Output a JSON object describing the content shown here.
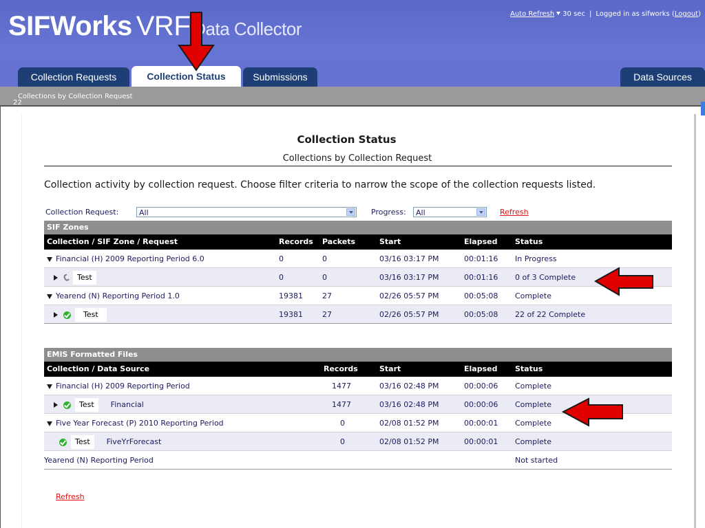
{
  "header": {
    "brand_bold": "SIFWorks",
    "brand_vrf": "VRF",
    "brand_dc": "Data Collector",
    "auto_refresh": "Auto Refresh",
    "refresh_interval": "30 sec",
    "logged_in_prefix": "Logged in as sifworks (",
    "logout": "Logout",
    "logged_in_suffix": ")"
  },
  "tabs": [
    {
      "label": "Collection Requests",
      "active": false
    },
    {
      "label": "Collection Status",
      "active": true
    },
    {
      "label": "Submissions",
      "active": false
    },
    {
      "label": "Data Sources",
      "active": false
    }
  ],
  "subbar": {
    "breadcrumb": "Collections by Collection Request",
    "counter": "22"
  },
  "page": {
    "title": "Collection Status",
    "subtitle": "Collections by Collection Request",
    "description": "Collection activity by collection request. Choose filter criteria to narrow the scope of the collection requests listed."
  },
  "filters": {
    "collection_request_label": "Collection Request:",
    "collection_request_value": "All",
    "progress_label": "Progress:",
    "progress_value": "All",
    "refresh": "Refresh"
  },
  "sif": {
    "section": "SIF Zones",
    "columns": [
      "Collection / SIF Zone / Request",
      "Records",
      "Packets",
      "Start",
      "Elapsed",
      "Status"
    ],
    "rows": [
      {
        "name": "Financial (H) 2009 Reporting Period 6.0",
        "records": "0",
        "packets": "0",
        "start": "03/16 03:17 PM",
        "elapsed": "00:01:16",
        "status": "In Progress"
      },
      {
        "name": "Test",
        "records": "0",
        "packets": "0",
        "start": "03/16 03:17 PM",
        "elapsed": "00:01:16",
        "status": "0 of 3 Complete"
      },
      {
        "name": "Yearend (N) Reporting Period 1.0",
        "records": "19381",
        "packets": "27",
        "start": "02/26 05:57 PM",
        "elapsed": "00:05:08",
        "status": "Complete"
      },
      {
        "name": "Test",
        "records": "19381",
        "packets": "27",
        "start": "02/26 05:57 PM",
        "elapsed": "00:05:08",
        "status": "22 of 22 Complete"
      }
    ]
  },
  "emis": {
    "section": "EMIS Formatted Files",
    "columns": [
      "Collection / Data Source",
      "Records",
      "Start",
      "Elapsed",
      "Status"
    ],
    "rows": [
      {
        "name": "Financial (H) 2009 Reporting Period",
        "records": "1477",
        "start": "03/16 02:48 PM",
        "elapsed": "00:00:06",
        "status": "Complete"
      },
      {
        "name": "Test",
        "source": "Financial",
        "records": "1477",
        "start": "03/16 02:48 PM",
        "elapsed": "00:00:06",
        "status": "Complete"
      },
      {
        "name": "Five Year Forecast (P) 2010 Reporting Period",
        "records": "0",
        "start": "02/08 01:52 PM",
        "elapsed": "00:00:01",
        "status": "Complete"
      },
      {
        "name": "Test",
        "source": "FiveYrForecast",
        "records": "0",
        "start": "02/08 01:52 PM",
        "elapsed": "00:00:01",
        "status": "Complete"
      },
      {
        "name": "Yearend (N) Reporting Period",
        "records": "",
        "start": "",
        "elapsed": "",
        "status": "Not started"
      }
    ]
  },
  "footer": {
    "refresh": "Refresh"
  },
  "colors": {
    "header": "#6674d4",
    "tab": "#1e3f76",
    "arrow": "#e00000",
    "section": "#8e8e8e",
    "link": "#e01010"
  }
}
